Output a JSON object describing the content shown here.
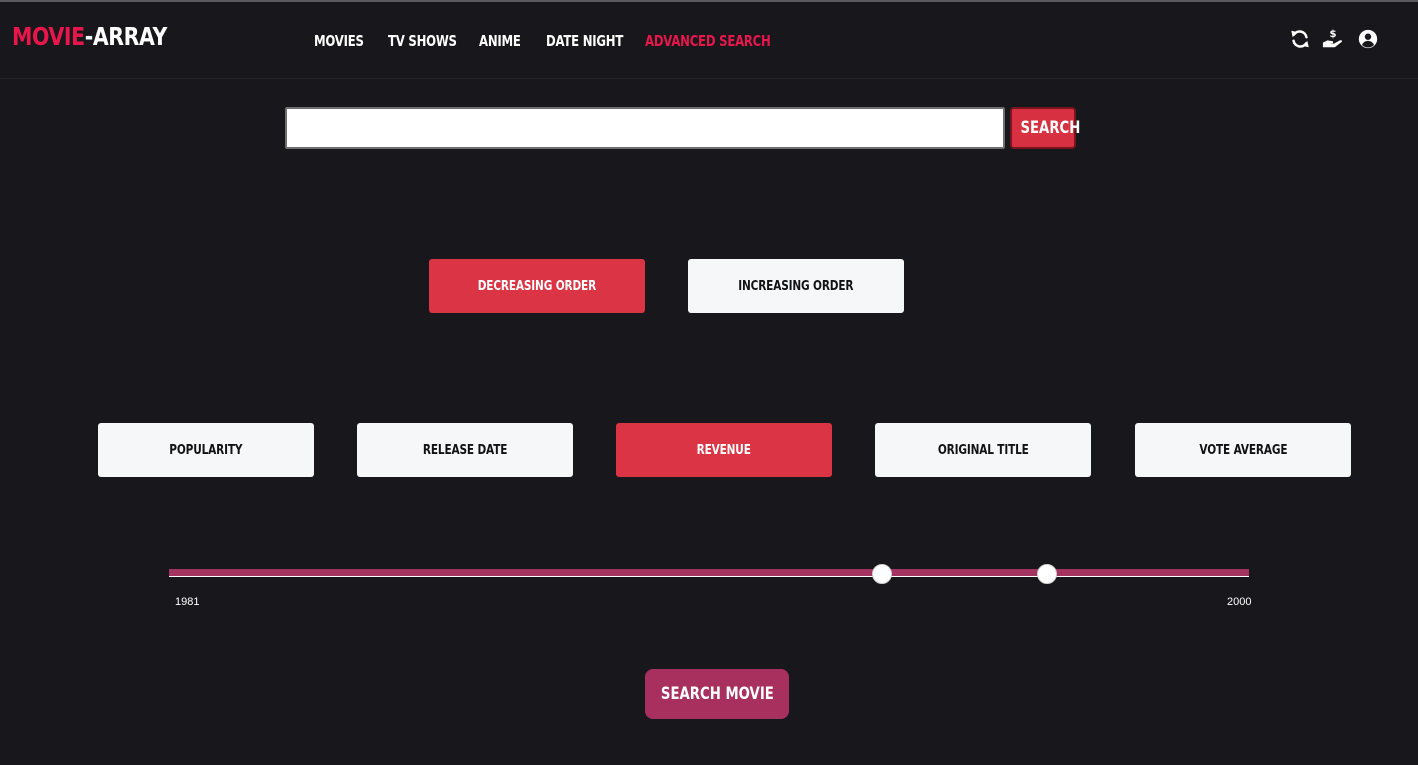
{
  "header": {
    "logo_primary": "MOVIE",
    "logo_secondary": "-ARRAY",
    "nav": [
      {
        "label": "MOVIES"
      },
      {
        "label": "TV SHOWS"
      },
      {
        "label": "ANIME"
      },
      {
        "label": "DATE NIGHT"
      },
      {
        "label": "ADVANCED SEARCH",
        "active": true
      }
    ],
    "icons": [
      "refresh-icon",
      "donate-hand-icon",
      "user-account-icon"
    ]
  },
  "search": {
    "value": "",
    "placeholder": "",
    "button_label": "SEARCH"
  },
  "order": {
    "options": [
      {
        "label": "DECREASING ORDER",
        "selected": true
      },
      {
        "label": "INCREASING ORDER",
        "selected": false
      }
    ]
  },
  "sort_by": {
    "options": [
      {
        "label": "POPULARITY",
        "selected": false
      },
      {
        "label": "RELEASE DATE",
        "selected": false
      },
      {
        "label": "REVENUE",
        "selected": true
      },
      {
        "label": "ORIGINAL TITLE",
        "selected": false
      },
      {
        "label": "VOTE AVERAGE",
        "selected": false
      }
    ]
  },
  "year_range": {
    "min_label": "1981",
    "max_label": "2000",
    "lower_fraction": 0.66,
    "upper_fraction": 0.813
  },
  "submit": {
    "label": "SEARCH MOVIE"
  },
  "colors": {
    "background": "#18171c",
    "accent_red": "#e8174b",
    "selected_button": "#db3444",
    "slider_and_submit": "#a8305f"
  }
}
